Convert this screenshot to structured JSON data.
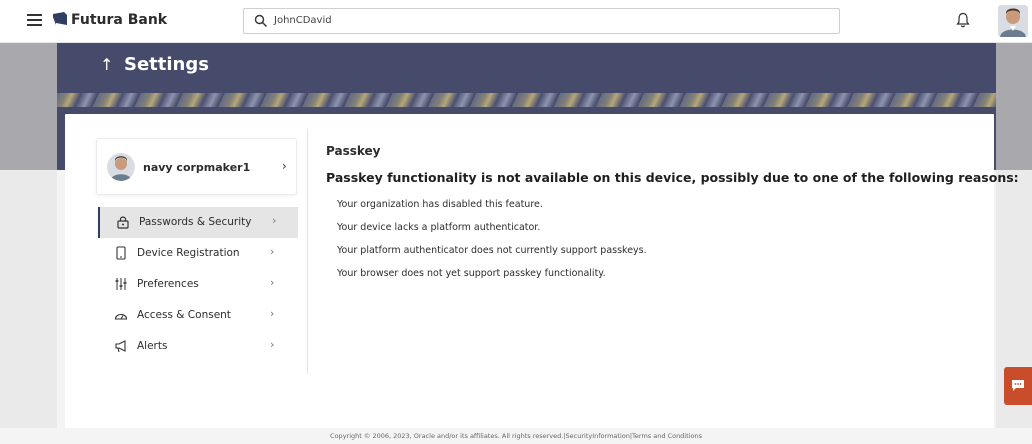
{
  "header": {
    "brand": "Futura Bank",
    "search_value": "JohnCDavid",
    "brand_color": "#2f3f61"
  },
  "page": {
    "title": "Settings"
  },
  "profile": {
    "name": "navy corpmaker1"
  },
  "menu": {
    "items": [
      {
        "label": "Passwords & Security",
        "icon": "lock-icon",
        "active": true
      },
      {
        "label": "Device Registration",
        "icon": "device-icon",
        "active": false
      },
      {
        "label": "Preferences",
        "icon": "sliders-icon",
        "active": false
      },
      {
        "label": "Access & Consent",
        "icon": "gauge-icon",
        "active": false
      },
      {
        "label": "Alerts",
        "icon": "megaphone-icon",
        "active": false
      }
    ]
  },
  "content": {
    "section_title": "Passkey",
    "heading": "Passkey functionality is not available on this device, possibly due to one of the following reasons:",
    "reasons": [
      "Your organization has disabled this feature.",
      "Your device lacks a platform authenticator.",
      "Your platform authenticator does not currently support passkeys.",
      "Your browser does not yet support passkey functionality."
    ]
  },
  "footer": {
    "text": "Copyright © 2006, 2023, Oracle and/or its affiliates. All rights reserved.|SecurityInformation|Terms and Conditions"
  },
  "colors": {
    "banner": "#464b6b",
    "chat_button": "#c94d2b",
    "active_menu_bg": "#e5e5e5"
  }
}
